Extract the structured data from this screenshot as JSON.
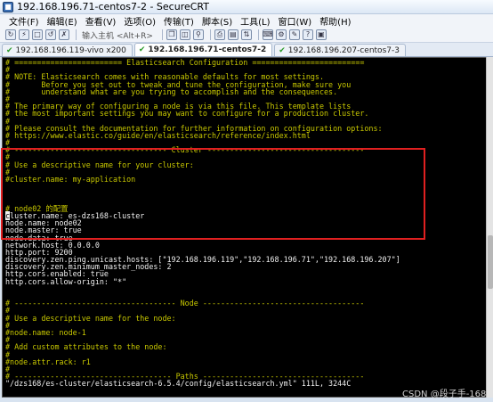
{
  "window": {
    "title": "192.168.196.71-centos7-2 - SecureCRT"
  },
  "menu": [
    "文件(F)",
    "编辑(E)",
    "查看(V)",
    "选项(O)",
    "传输(T)",
    "脚本(S)",
    "工具(L)",
    "窗口(W)",
    "帮助(H)"
  ],
  "toolbar": {
    "input_placeholder": "输入主机 <Alt+R>"
  },
  "tabs": [
    {
      "label": "192.168.196.119-vivo x200",
      "active": false
    },
    {
      "label": "192.168.196.71-centos7-2",
      "active": true
    },
    {
      "label": "192.168.196.207-centos7-3",
      "active": false
    }
  ],
  "terminal": {
    "lines": [
      {
        "text": "# ======================== Elasticsearch Configuration =========================",
        "kind": "comment"
      },
      {
        "text": "#",
        "kind": "comment"
      },
      {
        "text": "# NOTE: Elasticsearch comes with reasonable defaults for most settings.",
        "kind": "comment"
      },
      {
        "text": "#       Before you set out to tweak and tune the configuration, make sure you",
        "kind": "comment"
      },
      {
        "text": "#       understand what are you trying to accomplish and the consequences.",
        "kind": "comment"
      },
      {
        "text": "#",
        "kind": "comment"
      },
      {
        "text": "# The primary way of configuring a node is via this file. This template lists",
        "kind": "comment"
      },
      {
        "text": "# the most important settings you may want to configure for a production cluster.",
        "kind": "comment"
      },
      {
        "text": "#",
        "kind": "comment"
      },
      {
        "text": "# Please consult the documentation for further information on configuration options:",
        "kind": "comment"
      },
      {
        "text": "# https://www.elastic.co/guide/en/elasticsearch/reference/index.html",
        "kind": "comment"
      },
      {
        "text": "#",
        "kind": "comment"
      },
      {
        "text": "# ---------------------------------- Cluster -----------------------------------",
        "kind": "comment"
      },
      {
        "text": "#",
        "kind": "comment"
      },
      {
        "text": "# Use a descriptive name for your cluster:",
        "kind": "comment"
      },
      {
        "text": "#",
        "kind": "comment"
      },
      {
        "text": "#cluster.name: my-application",
        "kind": "comment"
      },
      {
        "text": "",
        "kind": "plain"
      },
      {
        "text": "",
        "kind": "plain"
      },
      {
        "text": "",
        "kind": "plain"
      },
      {
        "text": "# node02 的配置",
        "kind": "comment"
      },
      {
        "text": "cluster.name: es-dzs168-cluster",
        "kind": "plain",
        "cursor": true
      },
      {
        "text": "node.name: node02",
        "kind": "plain"
      },
      {
        "text": "node.master: true",
        "kind": "plain"
      },
      {
        "text": "node.data: true",
        "kind": "plain"
      },
      {
        "text": "network.host: 0.0.0.0",
        "kind": "plain"
      },
      {
        "text": "http.port: 9200",
        "kind": "plain"
      },
      {
        "text": "discovery.zen.ping.unicast.hosts: [\"192.168.196.119\",\"192.168.196.71\",\"192.168.196.207\"]",
        "kind": "plain"
      },
      {
        "text": "discovery.zen.minimum_master_nodes: 2",
        "kind": "plain"
      },
      {
        "text": "http.cors.enabled: true",
        "kind": "plain"
      },
      {
        "text": "http.cors.allow-origin: \"*\"",
        "kind": "plain"
      },
      {
        "text": "",
        "kind": "plain"
      },
      {
        "text": "",
        "kind": "plain"
      },
      {
        "text": "# ------------------------------------ Node ------------------------------------",
        "kind": "comment"
      },
      {
        "text": "#",
        "kind": "comment"
      },
      {
        "text": "# Use a descriptive name for the node:",
        "kind": "comment"
      },
      {
        "text": "#",
        "kind": "comment"
      },
      {
        "text": "#node.name: node-1",
        "kind": "comment"
      },
      {
        "text": "#",
        "kind": "comment"
      },
      {
        "text": "# Add custom attributes to the node:",
        "kind": "comment"
      },
      {
        "text": "#",
        "kind": "comment"
      },
      {
        "text": "#node.attr.rack: r1",
        "kind": "comment"
      },
      {
        "text": "#",
        "kind": "comment"
      },
      {
        "text": "# ----------------------------------- Paths ------------------------------------",
        "kind": "comment"
      },
      {
        "text": "\"/dzs168/es-cluster/elasticsearch-6.5.4/config/elasticsearch.yml\" 111L, 3244C",
        "kind": "plain"
      }
    ]
  },
  "watermark": "CSDN @段子手-168",
  "colors": {
    "terminal_bg": "#000000",
    "comment": "#c8c800",
    "highlight_border": "#e02020"
  }
}
